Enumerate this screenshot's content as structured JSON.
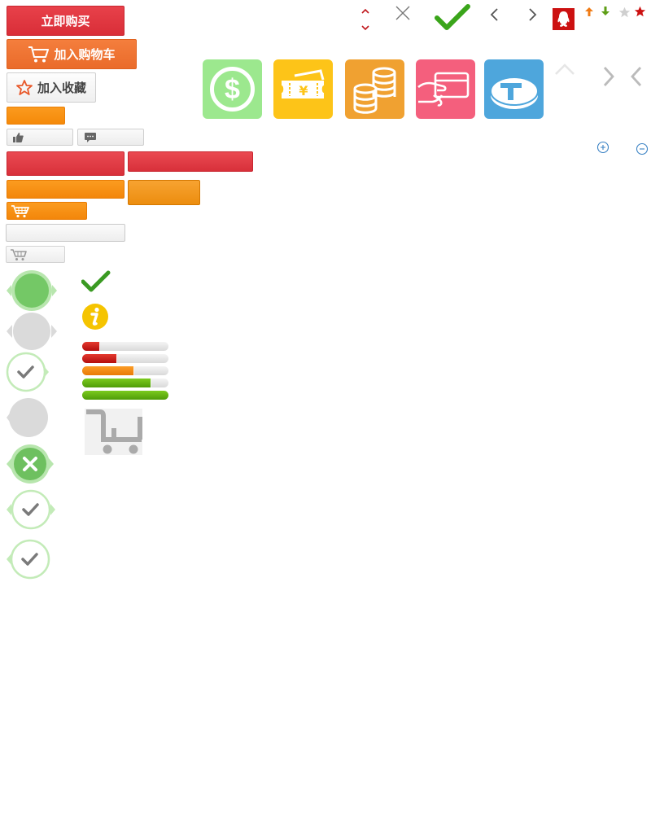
{
  "buttons": {
    "buy_now": "立即购买",
    "add_to_cart": "加入购物车",
    "add_to_favorites": "加入收藏"
  },
  "icons": [
    "caret-up-icon",
    "caret-down-icon",
    "close-icon",
    "checkmark-icon",
    "chevron-left-icon",
    "chevron-right-icon",
    "qq-icon",
    "arrow-up-icon",
    "arrow-down-icon",
    "star-empty-icon",
    "star-icon",
    "dollar-icon",
    "ticket-yuan-icon",
    "coins-icon",
    "card-hand-icon",
    "coin-box-icon",
    "plus-circle-icon",
    "minus-circle-icon",
    "info-icon",
    "shopping-cart-icon",
    "thumbs-up-icon",
    "comment-icon"
  ],
  "colors": {
    "red": "#dc3440",
    "orange_red": "#f0763a",
    "orange": "#f5900f",
    "green_tile": "#9ce78e",
    "yellow_tile": "#fdc417",
    "orange_tile": "#f0a132",
    "pink_tile": "#f45f7c",
    "blue_tile": "#4ea6db",
    "check_green": "#48a51e",
    "qq_red": "#cc1111"
  },
  "progress": [
    {
      "filled": 1,
      "color": "red"
    },
    {
      "filled": 2,
      "color": "red"
    },
    {
      "filled": 3,
      "color": "orange"
    },
    {
      "filled": 4,
      "color": "green"
    },
    {
      "filled": 5,
      "color": "green"
    }
  ]
}
